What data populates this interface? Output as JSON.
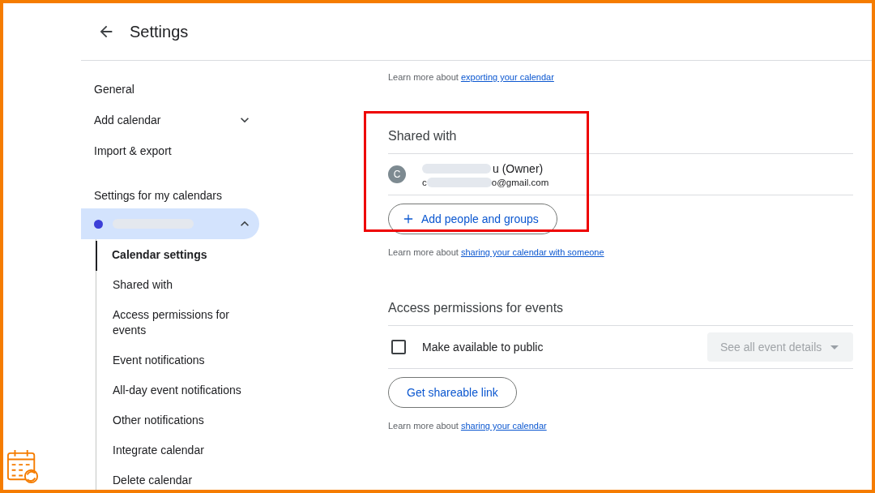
{
  "header": {
    "title": "Settings"
  },
  "sidebar": {
    "items": [
      {
        "label": "General",
        "expandable": false
      },
      {
        "label": "Add calendar",
        "expandable": true
      },
      {
        "label": "Import & export",
        "expandable": false
      }
    ],
    "section_title": "Settings for my calendars",
    "calendar": {
      "color": "#3c3fd8",
      "expanded": true
    },
    "sub_items": [
      {
        "label": "Calendar settings",
        "selected": true
      },
      {
        "label": "Shared with",
        "selected": false
      },
      {
        "label": "Access permissions for events",
        "selected": false
      },
      {
        "label": "Event notifications",
        "selected": false
      },
      {
        "label": "All-day event notifications",
        "selected": false
      },
      {
        "label": "Other notifications",
        "selected": false
      },
      {
        "label": "Integrate calendar",
        "selected": false
      },
      {
        "label": "Delete calendar",
        "selected": false
      }
    ]
  },
  "export_note": {
    "text": "Learn more about ",
    "link": "exporting your calendar"
  },
  "shared_with": {
    "title": "Shared with",
    "highlighted": true,
    "people": [
      {
        "initial": "C",
        "name_tail": "u (Owner)",
        "email_head": "c",
        "email_tail": "o@gmail.com"
      }
    ],
    "add_button": "Add people and groups",
    "note": {
      "text": "Learn more about ",
      "link": "sharing your calendar with someone"
    }
  },
  "access": {
    "title": "Access permissions for events",
    "public": {
      "label": "Make available to public",
      "checked": false
    },
    "detail_select": {
      "value": "See all event details",
      "disabled": true
    },
    "link_button": "Get shareable link",
    "note": {
      "text": "Learn more about ",
      "link": "sharing your calendar"
    }
  }
}
